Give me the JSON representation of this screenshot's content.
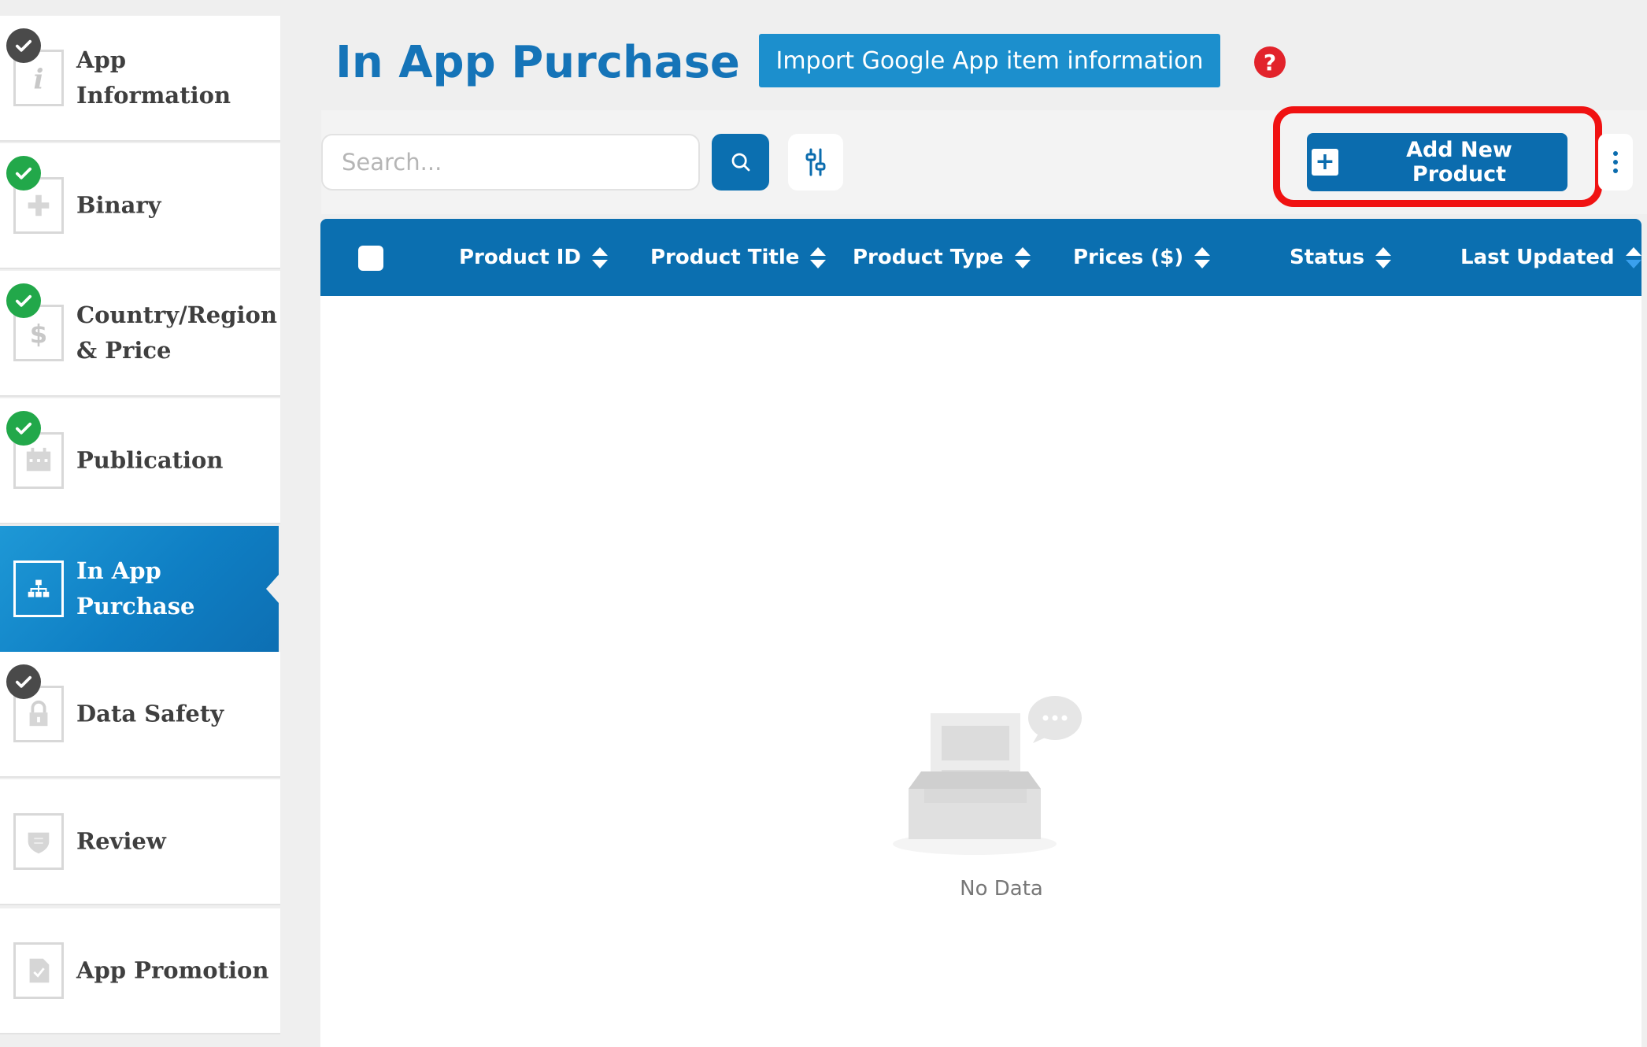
{
  "sidebar": {
    "items": [
      {
        "label_line1": "App",
        "label_line2": "Information",
        "status": "gray-check",
        "icon": "info-icon",
        "active": false
      },
      {
        "label_line1": "Binary",
        "label_line2": "",
        "status": "green-check",
        "icon": "puzzle-icon",
        "active": false
      },
      {
        "label_line1": "Country/Region",
        "label_line2": "& Price",
        "status": "green-check",
        "icon": "dollar-icon",
        "active": false
      },
      {
        "label_line1": "Publication",
        "label_line2": "",
        "status": "green-check",
        "icon": "calendar-icon",
        "active": false
      },
      {
        "label_line1": "In App",
        "label_line2": "Purchase",
        "status": "none",
        "icon": "hierarchy-icon",
        "active": true
      },
      {
        "label_line1": "Data Safety",
        "label_line2": "",
        "status": "gray-check",
        "icon": "lock-icon",
        "active": false
      },
      {
        "label_line1": "Review",
        "label_line2": "",
        "status": "none",
        "icon": "shield-icon",
        "active": false
      },
      {
        "label_line1": "App Promotion",
        "label_line2": "",
        "status": "none",
        "icon": "document-check-icon",
        "active": false
      }
    ]
  },
  "header": {
    "title": "In App Purchase",
    "import_label": "Import Google App item information",
    "help_glyph": "?"
  },
  "toolbar": {
    "search_placeholder": "Search...",
    "add_label": "Add New Product",
    "add_glyph": "+"
  },
  "table": {
    "columns": [
      "Product ID",
      "Product Title",
      "Product Type",
      "Prices ($)",
      "Status",
      "Last Updated"
    ],
    "rows": [],
    "empty_text": "No Data"
  },
  "colors": {
    "accent": "#0b6fb0",
    "title": "#1574b8",
    "highlight": "#f01212",
    "check_green": "#22a84a",
    "help_red": "#e2232b"
  }
}
